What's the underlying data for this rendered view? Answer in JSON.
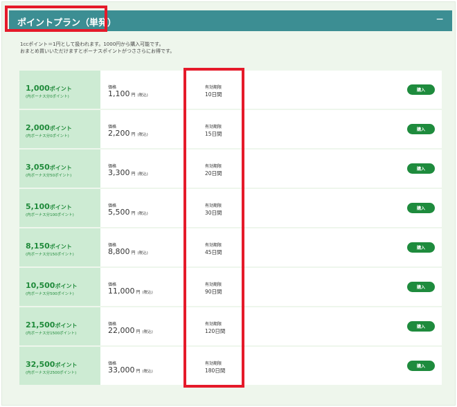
{
  "header": {
    "title": "ポイントプラン（単発）",
    "collapse_icon": "−"
  },
  "description": {
    "line1": "1ccポイント＝1円として扱われます。1000円から購入可能です。",
    "line2": "おまとめ買いいただけますとボーナスポイントがつささらにお得です。"
  },
  "labels": {
    "price": "価格",
    "validity": "有効期限",
    "yen": "円",
    "tax": "(税込)",
    "points_unit": "ポイント",
    "buy": "購入"
  },
  "plans": [
    {
      "points": "1,000",
      "bonus": "(内ボーナス分0ポイント)",
      "price": "1,100",
      "validity": "10日間"
    },
    {
      "points": "2,000",
      "bonus": "(内ボーナス分0ポイント)",
      "price": "2,200",
      "validity": "15日間"
    },
    {
      "points": "3,050",
      "bonus": "(内ボーナス分50ポイント)",
      "price": "3,300",
      "validity": "20日間"
    },
    {
      "points": "5,100",
      "bonus": "(内ボーナス分100ポイント)",
      "price": "5,500",
      "validity": "30日間"
    },
    {
      "points": "8,150",
      "bonus": "(内ボーナス分150ポイント)",
      "price": "8,800",
      "validity": "45日間"
    },
    {
      "points": "10,500",
      "bonus": "(内ボーナス分500ポイント)",
      "price": "11,000",
      "validity": "90日間"
    },
    {
      "points": "21,500",
      "bonus": "(内ボーナス分1500ポイント)",
      "price": "22,000",
      "validity": "120日間"
    },
    {
      "points": "32,500",
      "bonus": "(内ボーナス分2500ポイント)",
      "price": "33,000",
      "validity": "180日間"
    }
  ],
  "colors": {
    "header": "#3c8e93",
    "accent_green": "#1e8b3d",
    "points_bg": "#cdebd3",
    "highlight": "#e51a2a"
  }
}
